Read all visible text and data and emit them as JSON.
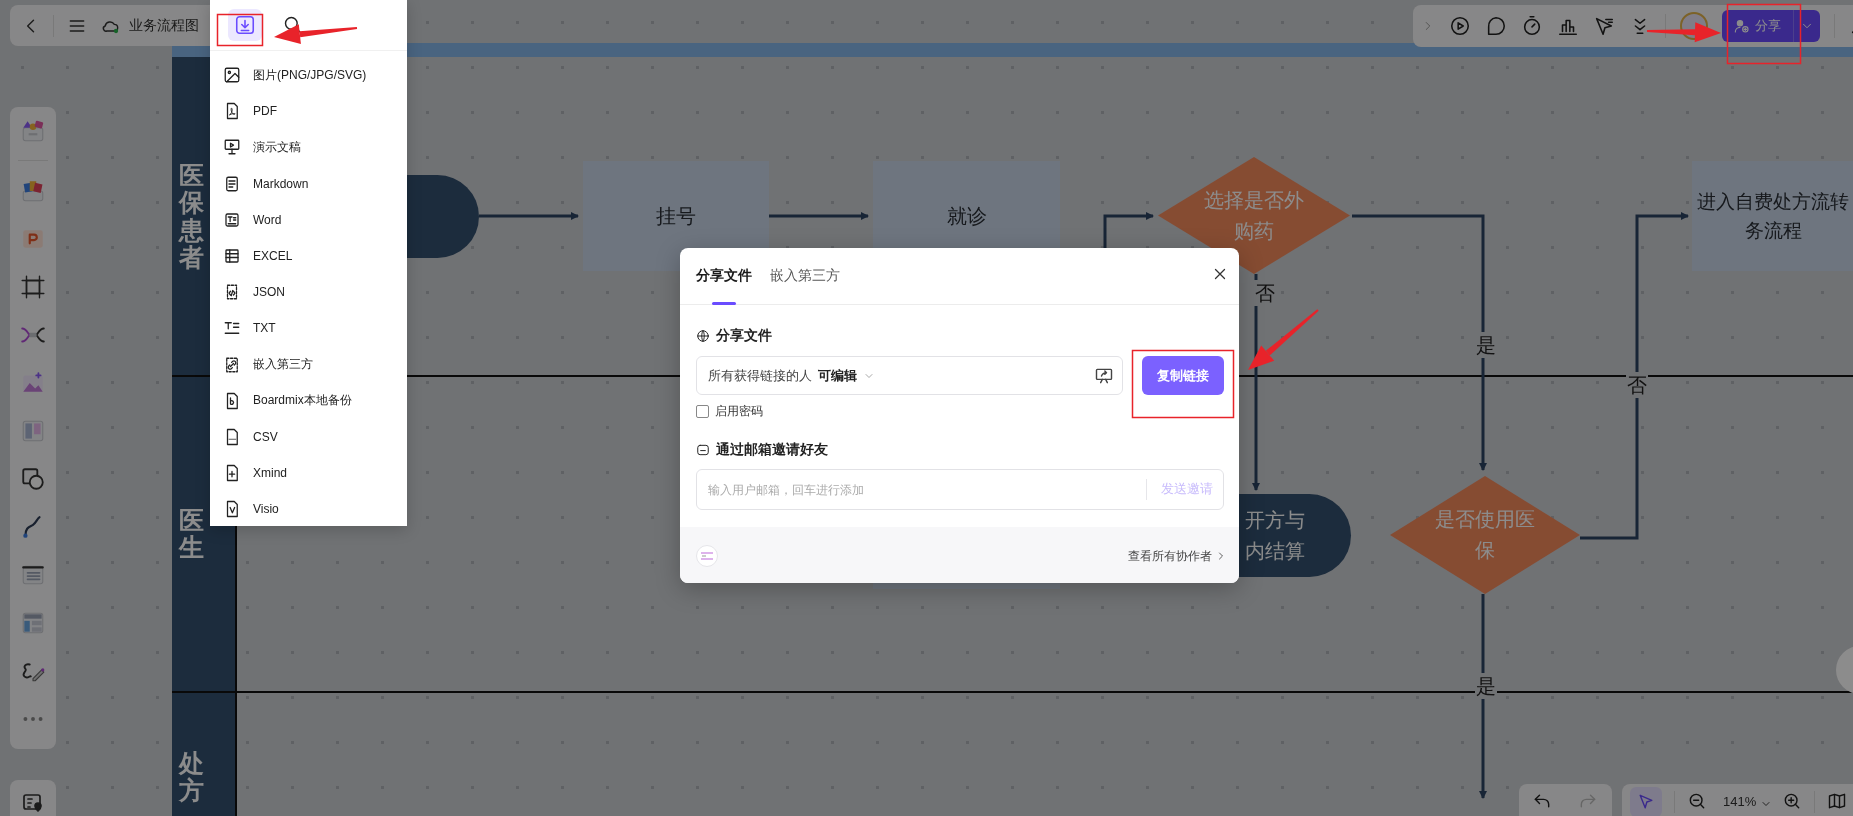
{
  "top_bar": {
    "title": "业务流程图"
  },
  "export_menu": {
    "items": [
      {
        "label": "图片(PNG/JPG/SVG)"
      },
      {
        "label": "PDF"
      },
      {
        "label": "演示文稿"
      },
      {
        "label": "Markdown"
      },
      {
        "label": "Word"
      },
      {
        "label": "EXCEL"
      },
      {
        "label": "JSON"
      },
      {
        "label": "TXT"
      },
      {
        "label": "嵌入第三方"
      },
      {
        "label": "Boardmix本地备份"
      },
      {
        "label": "CSV"
      },
      {
        "label": "Xmind"
      },
      {
        "label": "Visio"
      }
    ]
  },
  "lanes": [
    {
      "label": "医保患者"
    },
    {
      "label": "医生"
    },
    {
      "label": "处方"
    }
  ],
  "nodes": [
    {
      "kind": "terminal"
    },
    {
      "kind": "process",
      "text": "挂号"
    },
    {
      "kind": "process",
      "text": "就诊"
    },
    {
      "kind": "decision",
      "text": "选择是否外购药"
    },
    {
      "kind": "terminal",
      "lines": [
        "开方与",
        "内结算"
      ]
    },
    {
      "kind": "decision",
      "text": "是否使用医保"
    },
    {
      "kind": "process",
      "lines": [
        "进入自费处方流转",
        "务流程"
      ]
    },
    {
      "kind": "process"
    }
  ],
  "edge_labels": [
    "否",
    "是",
    "否",
    "是"
  ],
  "share_button": {
    "label": "分享"
  },
  "dialog": {
    "tabs": [
      {
        "label": "分享文件",
        "selected": true
      },
      {
        "label": "嵌入第三方",
        "selected": false
      }
    ],
    "section_title": "分享文件",
    "link_access": {
      "scope": "所有获得链接的人",
      "permission": "可编辑"
    },
    "copy_button": "复制链接",
    "password": {
      "label": "启用密码",
      "checked": false
    },
    "invite_title": "通过邮箱邀请好友",
    "email": {
      "placeholder": "输入用户邮箱，回车进行添加"
    },
    "send_button": {
      "label": "发送邀请",
      "disabled": true
    },
    "view_collaborators": "查看所有协作者"
  },
  "bottom_bar": {
    "zoom": "141%",
    "pointer_selected": true,
    "redo_disabled": true
  }
}
